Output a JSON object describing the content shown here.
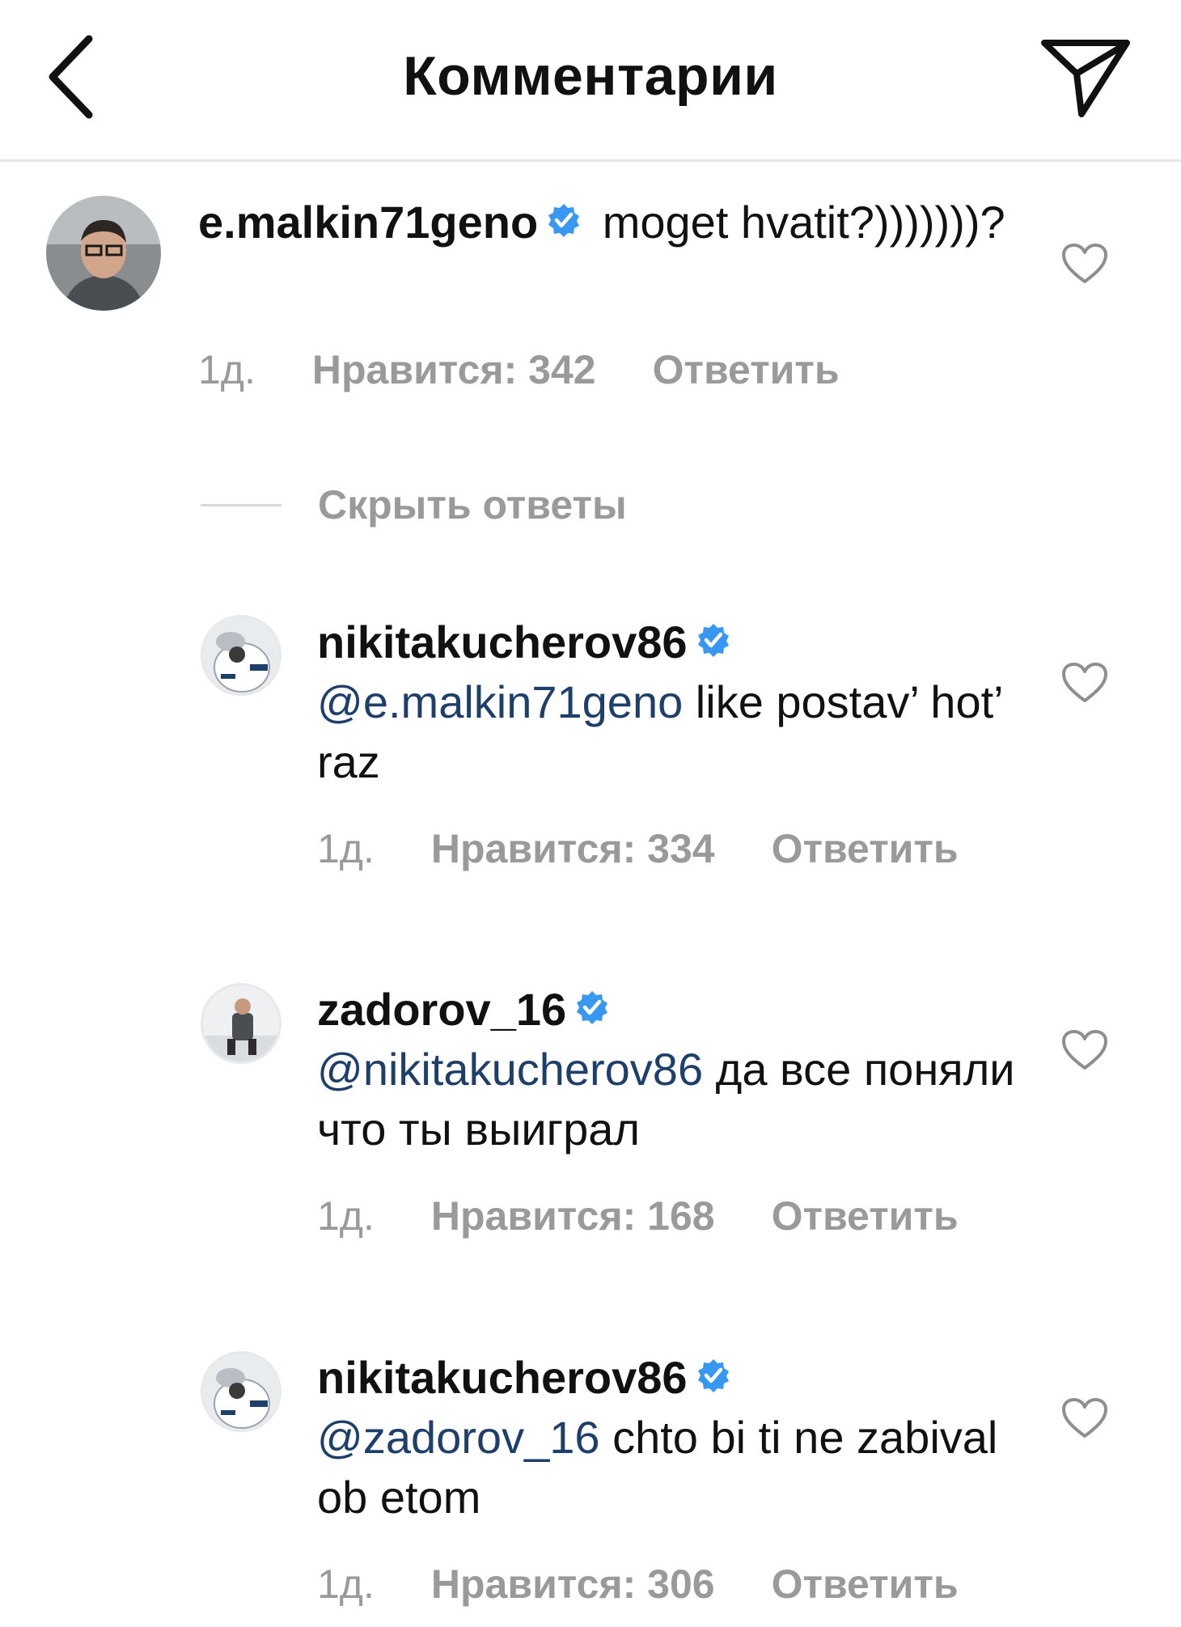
{
  "header": {
    "title": "Комментарии",
    "back_icon": "chevron-left-icon",
    "send_icon": "paper-plane-icon"
  },
  "colors": {
    "verified": "#3897f0",
    "mention": "#1f3f6b",
    "meta": "#9a9a9a",
    "divider": "#e6e6e6"
  },
  "comments": [
    {
      "username": "e.malkin71geno",
      "text": " moget hvatit?)))))))?",
      "time": "1д.",
      "likes": "Нравится: 342",
      "reply": "Ответить"
    },
    {
      "username": "nikitakucherov86",
      "mention": "@e.malkin71geno",
      "text": " like postav’ hot’ raz",
      "time": "1д.",
      "likes": "Нравится: 334",
      "reply": "Ответить"
    },
    {
      "username": "zadorov_16",
      "mention": "@nikitakucherov86",
      "text": " да все поняли что ты выиграл",
      "time": "1д.",
      "likes": "Нравится: 168",
      "reply": "Ответить"
    },
    {
      "username": "nikitakucherov86",
      "mention": "@zadorov_16",
      "text": " chto bi ti ne zabival ob etom",
      "time": "1д.",
      "likes": "Нравится: 306",
      "reply": "Ответить"
    }
  ],
  "hide_replies": "Скрыть ответы"
}
